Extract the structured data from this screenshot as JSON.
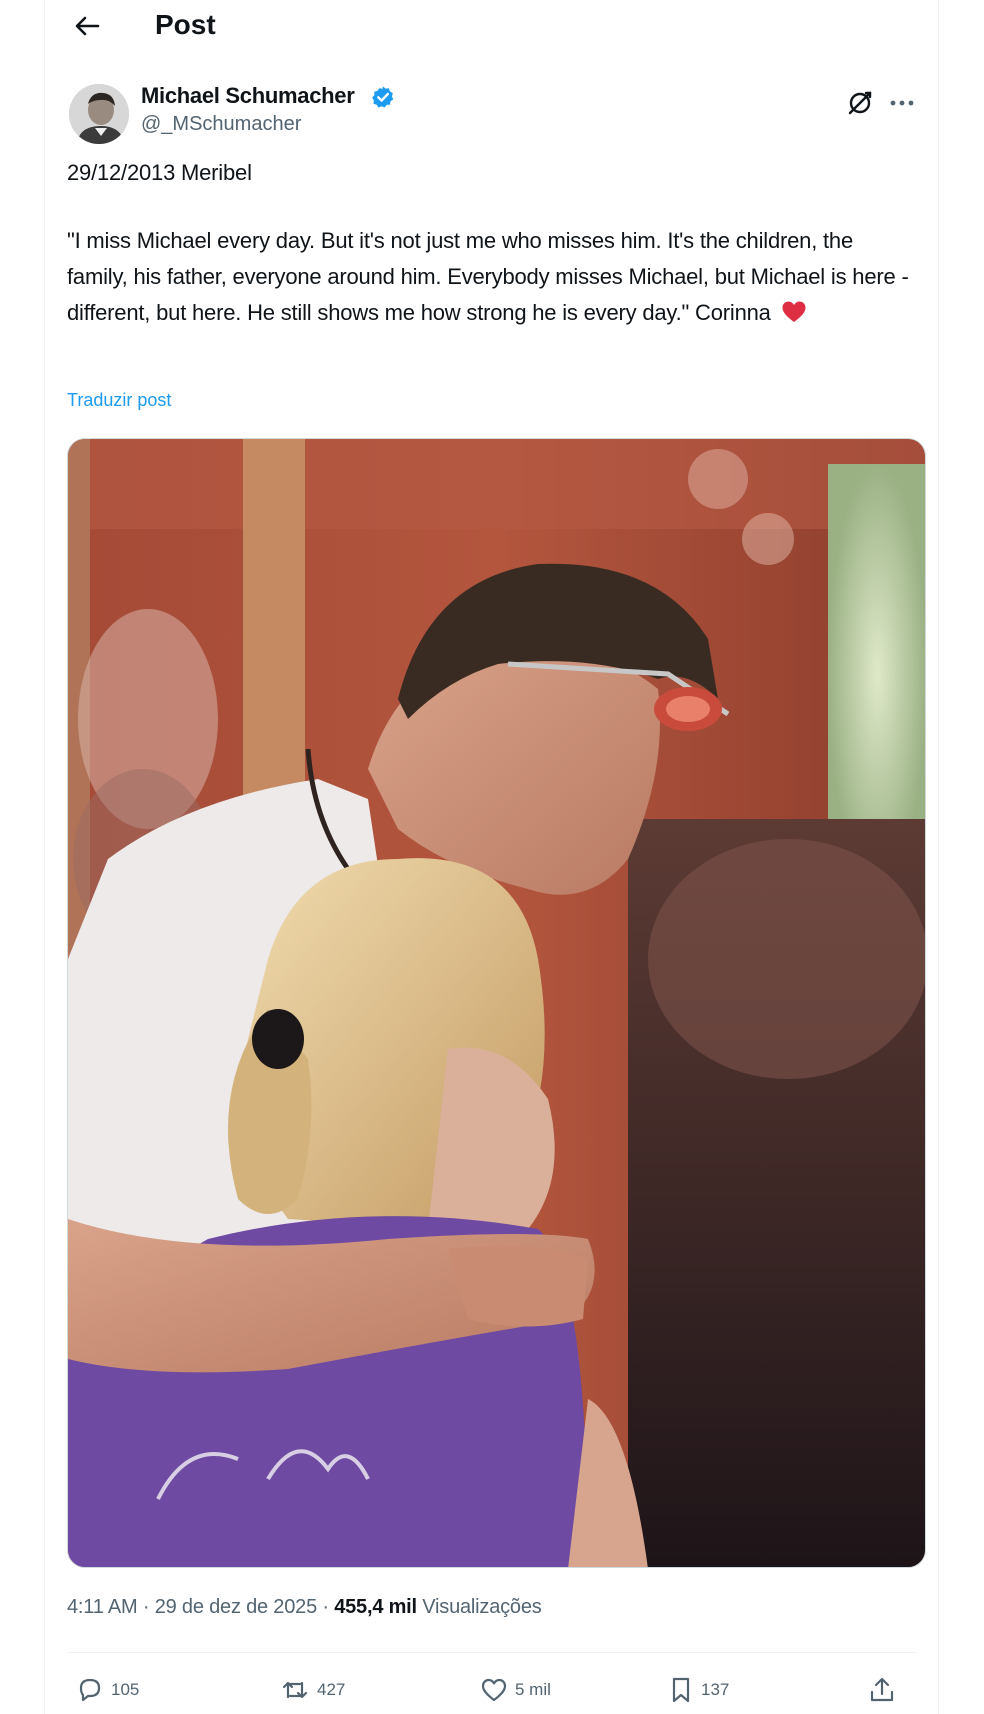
{
  "topbar": {
    "title": "Post",
    "back_icon": "arrow-left-icon"
  },
  "author": {
    "name": "Michael Schumacher",
    "handle": "@_MSchumacher",
    "verified": true,
    "verified_color": "#1d9bf0"
  },
  "tweet": {
    "line1": "29/12/2013 Meribel",
    "quote": "\"I miss Michael every day. But it's not just me who misses him. It's the children, the family, his father, everyone around him. Everybody misses Michael, but Michael is here - different, but here. He still shows me how strong he is every day.\" Corinna",
    "emoji": "red-heart-icon",
    "translate": "Traduzir post"
  },
  "meta": {
    "time": "4:11 AM",
    "sep1": " · ",
    "date": "29 de dez de 2025",
    "sep2": " · ",
    "views": "455,4 mil",
    "views_label": " Visualizações"
  },
  "actions": {
    "replies": "105",
    "reposts": "427",
    "likes": "5 mil",
    "bookmarks": "137"
  },
  "colors": {
    "text": "#0f1419",
    "secondary": "#536471",
    "link": "#1d9bf0",
    "heart": "#e0245e"
  }
}
